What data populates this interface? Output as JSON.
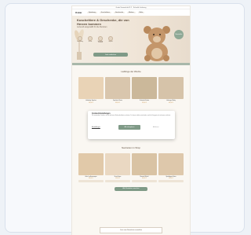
{
  "announcement": {
    "text": "Gratis Versand ab 49 € · Schnelle Lieferung"
  },
  "header": {
    "logo": "Oskar",
    "nav": [
      "Spielzeug",
      "Kuscheltiere",
      "Geschenke",
      "Marken",
      "Mehr"
    ]
  },
  "hero": {
    "title": "Kuscheltiere & Geschenke, die von Herzen kommen",
    "subtitle": "Liebevoll ausgewählt für die Kleinsten",
    "usps": [
      "Nachhaltig",
      "Sicher",
      "Schneller Versand",
      "Geprüft"
    ],
    "button": "Jetzt entdecken",
    "badge": "Bestseller"
  },
  "section_popular": {
    "title": "Lieblinge der Woche",
    "products": [
      {
        "name": "Holzbaby Spielset",
        "price": "24,90 €",
        "color": "#e9d3b6"
      },
      {
        "name": "Spieltisch Natur",
        "price": "39,90 €",
        "color": "#d9c6ad"
      },
      {
        "name": "Schaukel Kinder",
        "price": "59,90 €",
        "color": "#cbb89a"
      },
      {
        "name": "Holzregal Baby",
        "price": "49,90 €",
        "color": "#d6c3a9"
      }
    ]
  },
  "cookie": {
    "title": "Cookie-Einstellungen",
    "text": "Wir verwenden Cookies, um dir das beste Einkaufserlebnis zu bieten. Du kannst selbst entscheiden, welche Kategorien du zulassen möchtest.",
    "settings": "Einstellungen",
    "accept": "Alle akzeptieren",
    "deny": "Ablehnen"
  },
  "section_new": {
    "title": "Neuheiten im Shop",
    "products": [
      {
        "name": "Holz Lauflernwagen",
        "price": "34,90 €",
        "color": "#e1c9a9"
      },
      {
        "name": "Strick Hase",
        "price": "19,90 €",
        "color": "#ead8c2"
      },
      {
        "name": "Motorik Würfel",
        "price": "44,90 €",
        "color": "#d9c3a4"
      },
      {
        "name": "Spielbogen Natur",
        "price": "29,90 €",
        "color": "#dec8ab"
      }
    ],
    "cta": "Alle Neuheiten ansehen"
  },
  "newsletter": {
    "text": "Jetzt zum Newsletter anmelden"
  }
}
